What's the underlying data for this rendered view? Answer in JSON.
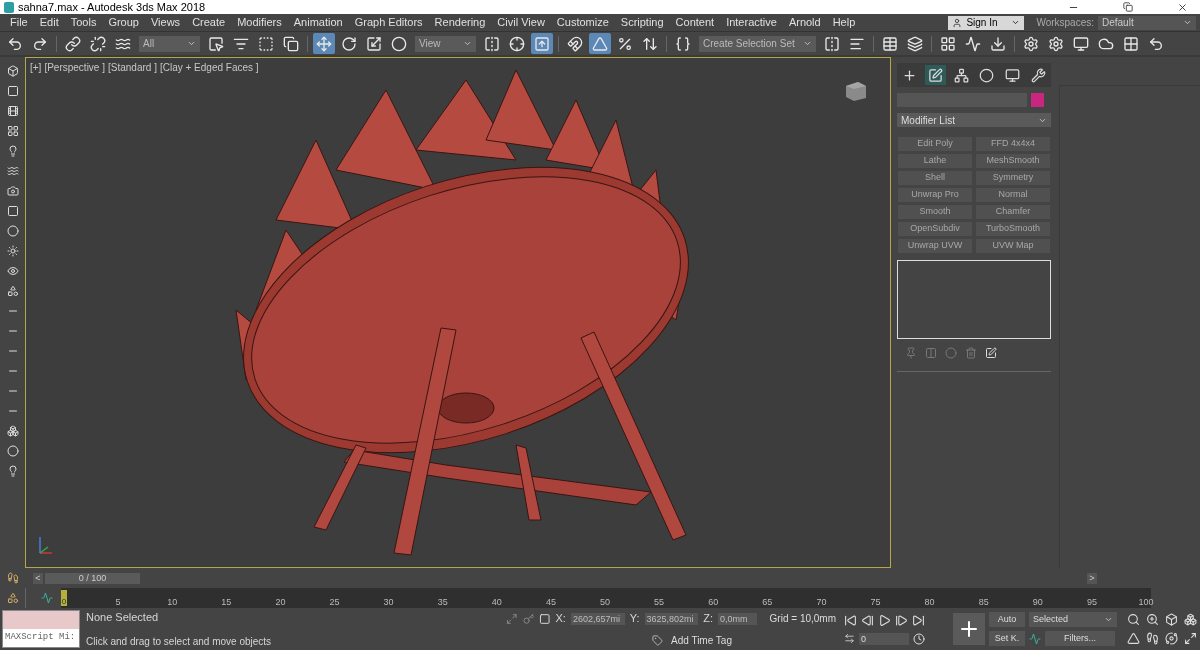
{
  "window": {
    "title": "sahna7.max - Autodesk 3ds Max 2018"
  },
  "menu": [
    "File",
    "Edit",
    "Tools",
    "Group",
    "Views",
    "Create",
    "Modifiers",
    "Animation",
    "Graph Editors",
    "Rendering",
    "Civil View",
    "Customize",
    "Scripting",
    "Content",
    "Interactive",
    "Arnold",
    "Help"
  ],
  "sign_in": "Sign In",
  "workspaces": {
    "label": "Workspaces:",
    "value": "Default"
  },
  "toolbar": [
    {
      "kind": "button",
      "selected": false
    },
    {
      "kind": "button",
      "selected": false
    },
    {
      "kind": "sep"
    },
    {
      "kind": "button",
      "selected": false
    },
    {
      "kind": "button",
      "selected": false
    },
    {
      "kind": "button",
      "selected": false
    },
    {
      "kind": "dropdown",
      "value": "All"
    },
    {
      "kind": "button",
      "selected": false
    },
    {
      "kind": "button",
      "selected": false
    },
    {
      "kind": "button",
      "selected": false
    },
    {
      "kind": "button",
      "selected": false
    },
    {
      "kind": "sep"
    },
    {
      "kind": "button",
      "selected": true
    },
    {
      "kind": "button",
      "selected": false
    },
    {
      "kind": "button",
      "selected": false
    },
    {
      "kind": "button",
      "selected": false
    },
    {
      "kind": "dropdown",
      "value": "View"
    },
    {
      "kind": "button",
      "selected": false
    },
    {
      "kind": "button",
      "selected": false
    },
    {
      "kind": "button",
      "selected": true
    },
    {
      "kind": "sep"
    },
    {
      "kind": "button",
      "selected": false
    },
    {
      "kind": "button",
      "selected": true
    },
    {
      "kind": "button",
      "selected": false
    },
    {
      "kind": "button",
      "selected": false
    },
    {
      "kind": "sep"
    },
    {
      "kind": "button",
      "selected": false
    },
    {
      "kind": "dropdown",
      "value": "Create Selection Set"
    },
    {
      "kind": "button",
      "selected": false
    },
    {
      "kind": "button",
      "selected": false
    },
    {
      "kind": "sep"
    },
    {
      "kind": "button",
      "selected": false
    },
    {
      "kind": "button",
      "selected": false
    },
    {
      "kind": "sep"
    },
    {
      "kind": "button",
      "selected": false
    },
    {
      "kind": "button",
      "selected": false
    },
    {
      "kind": "button",
      "selected": false
    },
    {
      "kind": "sep"
    },
    {
      "kind": "button",
      "selected": false
    },
    {
      "kind": "button",
      "selected": false
    },
    {
      "kind": "button",
      "selected": false
    },
    {
      "kind": "button",
      "selected": false
    },
    {
      "kind": "button",
      "selected": false
    },
    {
      "kind": "button",
      "selected": false
    }
  ],
  "viewport": {
    "labels": [
      "[+]",
      "[Perspective ]",
      "[Standard ]",
      "[Clay + Edged Faces ]"
    ]
  },
  "command_panel": {
    "tabs": [
      {
        "selected": false
      },
      {
        "selected": true
      },
      {
        "selected": false
      },
      {
        "selected": false
      },
      {
        "selected": false
      },
      {
        "selected": false
      }
    ],
    "modifier_list": "Modifier List",
    "modifiers": [
      {
        "label": "Edit Poly",
        "disabled": true
      },
      {
        "label": "FFD 4x4x4",
        "disabled": true
      },
      {
        "label": "Lathe",
        "disabled": true
      },
      {
        "label": "MeshSmooth",
        "disabled": true
      },
      {
        "label": "Shell",
        "disabled": true
      },
      {
        "label": "Symmetry",
        "disabled": true
      },
      {
        "label": "Unwrap Pro",
        "disabled": true
      },
      {
        "label": "Normal",
        "disabled": true
      },
      {
        "label": "Smooth",
        "disabled": true
      },
      {
        "label": "Chamfer",
        "disabled": true
      },
      {
        "label": "OpenSubdiv",
        "disabled": true
      },
      {
        "label": "TurboSmooth",
        "disabled": true
      },
      {
        "label": "Unwrap UVW",
        "disabled": true
      },
      {
        "label": "UVW Map",
        "disabled": true
      }
    ]
  },
  "timeline": {
    "slider": "0 / 100",
    "prev": "<",
    "next": ">",
    "frame": "0",
    "level": 0,
    "ticks": [
      "5",
      "10",
      "15",
      "20",
      "25",
      "30",
      "35",
      "40",
      "45",
      "50",
      "55",
      "60",
      "65",
      "70",
      "75",
      "80",
      "85",
      "90",
      "95",
      "100"
    ]
  },
  "status": {
    "maxscript": "MAXScript Mi:",
    "selection": "None Selected",
    "prompt": "Click and drag to select and move objects",
    "x_label": "X:",
    "x": "2602,657mi",
    "y_label": "Y:",
    "y": "3625,802mi",
    "z_label": "Z:",
    "z": "0,0mm",
    "grid": "Grid = 10,0mm",
    "add_time_tag": "Add Time Tag",
    "frame": "0",
    "auto": "Auto",
    "set_key": "Set K.",
    "key_filter": "Selected",
    "filters": "Filters..."
  }
}
